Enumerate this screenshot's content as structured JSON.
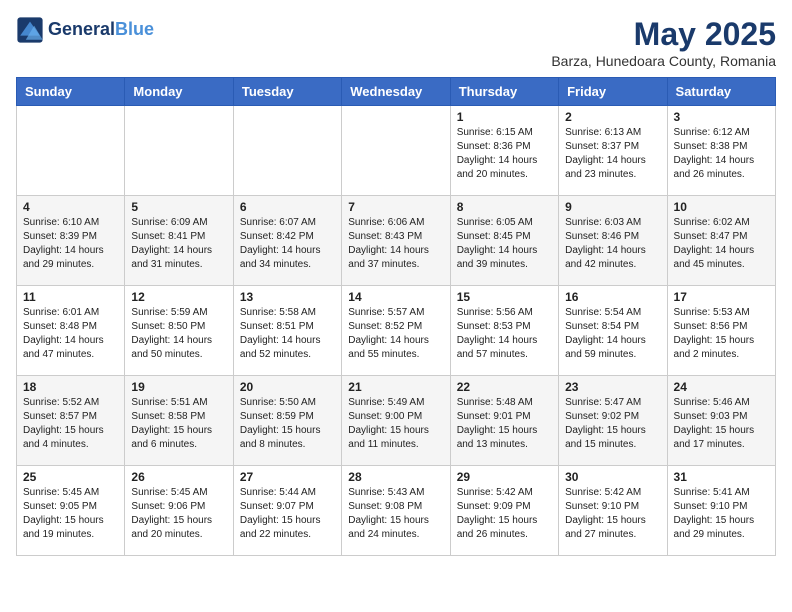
{
  "header": {
    "logo_line1": "General",
    "logo_line2": "Blue",
    "title": "May 2025",
    "subtitle": "Barza, Hunedoara County, Romania"
  },
  "weekdays": [
    "Sunday",
    "Monday",
    "Tuesday",
    "Wednesday",
    "Thursday",
    "Friday",
    "Saturday"
  ],
  "weeks": [
    [
      {
        "day": "",
        "info": ""
      },
      {
        "day": "",
        "info": ""
      },
      {
        "day": "",
        "info": ""
      },
      {
        "day": "",
        "info": ""
      },
      {
        "day": "1",
        "info": "Sunrise: 6:15 AM\nSunset: 8:36 PM\nDaylight: 14 hours\nand 20 minutes."
      },
      {
        "day": "2",
        "info": "Sunrise: 6:13 AM\nSunset: 8:37 PM\nDaylight: 14 hours\nand 23 minutes."
      },
      {
        "day": "3",
        "info": "Sunrise: 6:12 AM\nSunset: 8:38 PM\nDaylight: 14 hours\nand 26 minutes."
      }
    ],
    [
      {
        "day": "4",
        "info": "Sunrise: 6:10 AM\nSunset: 8:39 PM\nDaylight: 14 hours\nand 29 minutes."
      },
      {
        "day": "5",
        "info": "Sunrise: 6:09 AM\nSunset: 8:41 PM\nDaylight: 14 hours\nand 31 minutes."
      },
      {
        "day": "6",
        "info": "Sunrise: 6:07 AM\nSunset: 8:42 PM\nDaylight: 14 hours\nand 34 minutes."
      },
      {
        "day": "7",
        "info": "Sunrise: 6:06 AM\nSunset: 8:43 PM\nDaylight: 14 hours\nand 37 minutes."
      },
      {
        "day": "8",
        "info": "Sunrise: 6:05 AM\nSunset: 8:45 PM\nDaylight: 14 hours\nand 39 minutes."
      },
      {
        "day": "9",
        "info": "Sunrise: 6:03 AM\nSunset: 8:46 PM\nDaylight: 14 hours\nand 42 minutes."
      },
      {
        "day": "10",
        "info": "Sunrise: 6:02 AM\nSunset: 8:47 PM\nDaylight: 14 hours\nand 45 minutes."
      }
    ],
    [
      {
        "day": "11",
        "info": "Sunrise: 6:01 AM\nSunset: 8:48 PM\nDaylight: 14 hours\nand 47 minutes."
      },
      {
        "day": "12",
        "info": "Sunrise: 5:59 AM\nSunset: 8:50 PM\nDaylight: 14 hours\nand 50 minutes."
      },
      {
        "day": "13",
        "info": "Sunrise: 5:58 AM\nSunset: 8:51 PM\nDaylight: 14 hours\nand 52 minutes."
      },
      {
        "day": "14",
        "info": "Sunrise: 5:57 AM\nSunset: 8:52 PM\nDaylight: 14 hours\nand 55 minutes."
      },
      {
        "day": "15",
        "info": "Sunrise: 5:56 AM\nSunset: 8:53 PM\nDaylight: 14 hours\nand 57 minutes."
      },
      {
        "day": "16",
        "info": "Sunrise: 5:54 AM\nSunset: 8:54 PM\nDaylight: 14 hours\nand 59 minutes."
      },
      {
        "day": "17",
        "info": "Sunrise: 5:53 AM\nSunset: 8:56 PM\nDaylight: 15 hours\nand 2 minutes."
      }
    ],
    [
      {
        "day": "18",
        "info": "Sunrise: 5:52 AM\nSunset: 8:57 PM\nDaylight: 15 hours\nand 4 minutes."
      },
      {
        "day": "19",
        "info": "Sunrise: 5:51 AM\nSunset: 8:58 PM\nDaylight: 15 hours\nand 6 minutes."
      },
      {
        "day": "20",
        "info": "Sunrise: 5:50 AM\nSunset: 8:59 PM\nDaylight: 15 hours\nand 8 minutes."
      },
      {
        "day": "21",
        "info": "Sunrise: 5:49 AM\nSunset: 9:00 PM\nDaylight: 15 hours\nand 11 minutes."
      },
      {
        "day": "22",
        "info": "Sunrise: 5:48 AM\nSunset: 9:01 PM\nDaylight: 15 hours\nand 13 minutes."
      },
      {
        "day": "23",
        "info": "Sunrise: 5:47 AM\nSunset: 9:02 PM\nDaylight: 15 hours\nand 15 minutes."
      },
      {
        "day": "24",
        "info": "Sunrise: 5:46 AM\nSunset: 9:03 PM\nDaylight: 15 hours\nand 17 minutes."
      }
    ],
    [
      {
        "day": "25",
        "info": "Sunrise: 5:45 AM\nSunset: 9:05 PM\nDaylight: 15 hours\nand 19 minutes."
      },
      {
        "day": "26",
        "info": "Sunrise: 5:45 AM\nSunset: 9:06 PM\nDaylight: 15 hours\nand 20 minutes."
      },
      {
        "day": "27",
        "info": "Sunrise: 5:44 AM\nSunset: 9:07 PM\nDaylight: 15 hours\nand 22 minutes."
      },
      {
        "day": "28",
        "info": "Sunrise: 5:43 AM\nSunset: 9:08 PM\nDaylight: 15 hours\nand 24 minutes."
      },
      {
        "day": "29",
        "info": "Sunrise: 5:42 AM\nSunset: 9:09 PM\nDaylight: 15 hours\nand 26 minutes."
      },
      {
        "day": "30",
        "info": "Sunrise: 5:42 AM\nSunset: 9:10 PM\nDaylight: 15 hours\nand 27 minutes."
      },
      {
        "day": "31",
        "info": "Sunrise: 5:41 AM\nSunset: 9:10 PM\nDaylight: 15 hours\nand 29 minutes."
      }
    ]
  ]
}
